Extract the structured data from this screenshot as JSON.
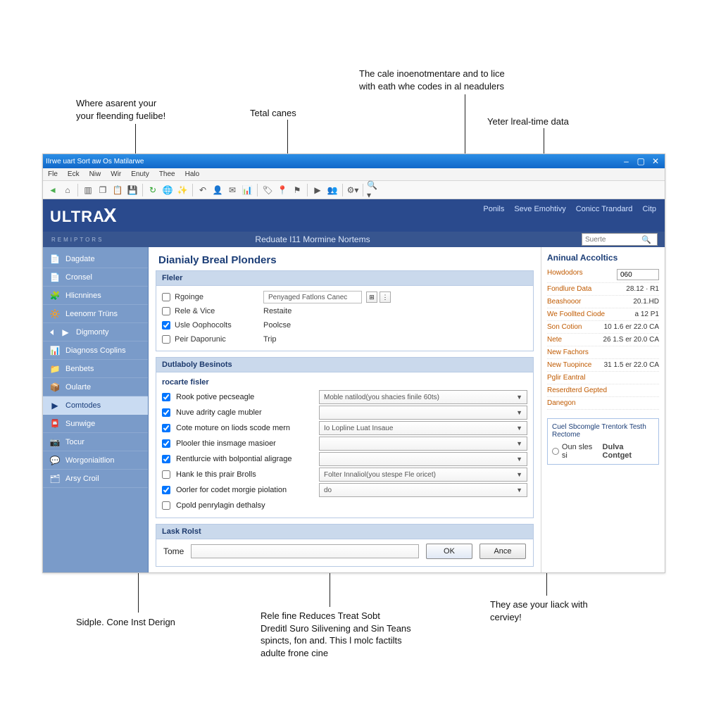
{
  "callouts": {
    "c1": "Where asarent your\nyour fleending fuelibe!",
    "c2": "Tetal canes",
    "c3": "The cale inoenotmentare and to lice\nwith eath whe codes in al neadulers",
    "c4": "Yeter lreal-time data",
    "c5": "Sidple. Cone Inst Derign",
    "c6": "Rele fine Reduces Treat Sobt\nDreditl Suro Silivening and Sin Teans\nspincts, fon and. This l molc factilts\nadulte frone cine",
    "c7": "They ase your liack with\ncerviey!"
  },
  "window": {
    "title": "IIrwe uart Sort aw Os Matilarwe",
    "controls": {
      "min": "–",
      "max": "▢",
      "close": "✕"
    }
  },
  "menus": [
    "Fle",
    "Eck",
    "Niw",
    "Wir",
    "Enuty",
    "Thee",
    "Halo"
  ],
  "brand": {
    "logo_main": "ULTRA",
    "logo_x": "X",
    "logo_sub": "REMIPTORS",
    "module": "Reduate I11 Mormine Nortems",
    "links": [
      "Ponils",
      "Seve Emohtivy",
      "Conicc Trandard",
      "Citp"
    ],
    "search_placeholder": "Suerte"
  },
  "sidebar": [
    {
      "icon": "📄",
      "label": "Dagdate"
    },
    {
      "icon": "📄",
      "label": "Cronsel"
    },
    {
      "icon": "🧩",
      "label": "Hlicnnines"
    },
    {
      "icon": "🔆",
      "label": "Leenomr Trüns"
    },
    {
      "icon": "▶",
      "label": "Digmonty",
      "expandable": true
    },
    {
      "icon": "📊",
      "label": "Diagnoss Coplins"
    },
    {
      "icon": "📁",
      "label": "Benbets"
    },
    {
      "icon": "📦",
      "label": "Oularte"
    },
    {
      "icon": "▶",
      "label": "Comtodes",
      "selected": true
    },
    {
      "icon": "📮",
      "label": "Sunwige"
    },
    {
      "icon": "📷",
      "label": "Tocur"
    },
    {
      "icon": "💬",
      "label": "Worgoniaitlion"
    },
    {
      "icon": "🗂",
      "label": "Arsy Croil"
    }
  ],
  "main": {
    "title": "Dianialy Breal Plonders",
    "filter_panel_title": "Fleler",
    "filters": [
      {
        "checked": false,
        "label": "Rgoinge",
        "value": "Penyaged Fatlons Canec",
        "has_input": true
      },
      {
        "checked": false,
        "label": "Rele & Vice",
        "value": "Restaite"
      },
      {
        "checked": true,
        "label": "Usle Oophocolts",
        "value": "Poolcse"
      },
      {
        "checked": false,
        "label": "Peir Daporunic",
        "value": "Trip"
      }
    ],
    "detail_panel_title": "Dutlaboly Besinots",
    "detail_subhead": "rocarte fisler",
    "detail_options": [
      {
        "checked": true,
        "label": "Rook potive pecseagle",
        "dd": "Moble natilod(you shacies finile 60ts)"
      },
      {
        "checked": true,
        "label": "Nuve adrity cagle mubler",
        "dd": ""
      },
      {
        "checked": true,
        "label": "Cote moture on liods scode mern",
        "dd": "Io Lopline Luat Insaue"
      },
      {
        "checked": true,
        "label": "Plooler thie insmage masioer",
        "dd": ""
      },
      {
        "checked": true,
        "label": "Rentlurcie with bolpontial aligrage",
        "dd": ""
      },
      {
        "checked": false,
        "label": "Hank Ie this prair Brolls",
        "dd": "Folter Innaliol(you stespe Fle oricet)"
      },
      {
        "checked": true,
        "label": "Oorler for codet morgie piolation",
        "dd": "do"
      },
      {
        "checked": false,
        "label": "Cpold penrylagin dethalsy"
      }
    ],
    "lask_panel_title": "Lask Rolst",
    "lask_label": "Tome",
    "btn_ok": "OK",
    "btn_ance": "Ance"
  },
  "right": {
    "title": "Aninual Accoltics",
    "rows": [
      {
        "k": "Howdodors",
        "v": "060",
        "input": true
      },
      {
        "k": "Fondlure Data",
        "v": "28.12 · R1"
      },
      {
        "k": "Beashooor",
        "v": "20.1.HD"
      },
      {
        "k": "We Foollted Ciode",
        "v": "a 12 P1"
      },
      {
        "k": "Son Cotion",
        "v": "10 1.6 er 22.0 CA"
      },
      {
        "k": "Nete",
        "v": "26 1.S er 20.0 CA"
      },
      {
        "k": "New Fachors",
        "v": ""
      },
      {
        "k": "New Tuopince",
        "v": "31 1.5 er 22.0 CA"
      },
      {
        "k": "Pglir Eantral",
        "v": ""
      },
      {
        "k": "Reserdterd Gepted",
        "v": ""
      },
      {
        "k": "Danegon",
        "v": ""
      }
    ],
    "promo_hd": "Cuel Sbcomgle Trentork Testh Rectome",
    "promo_btn_prefix": "Oun sles si",
    "promo_btn_bold": "Dulva Contget"
  }
}
